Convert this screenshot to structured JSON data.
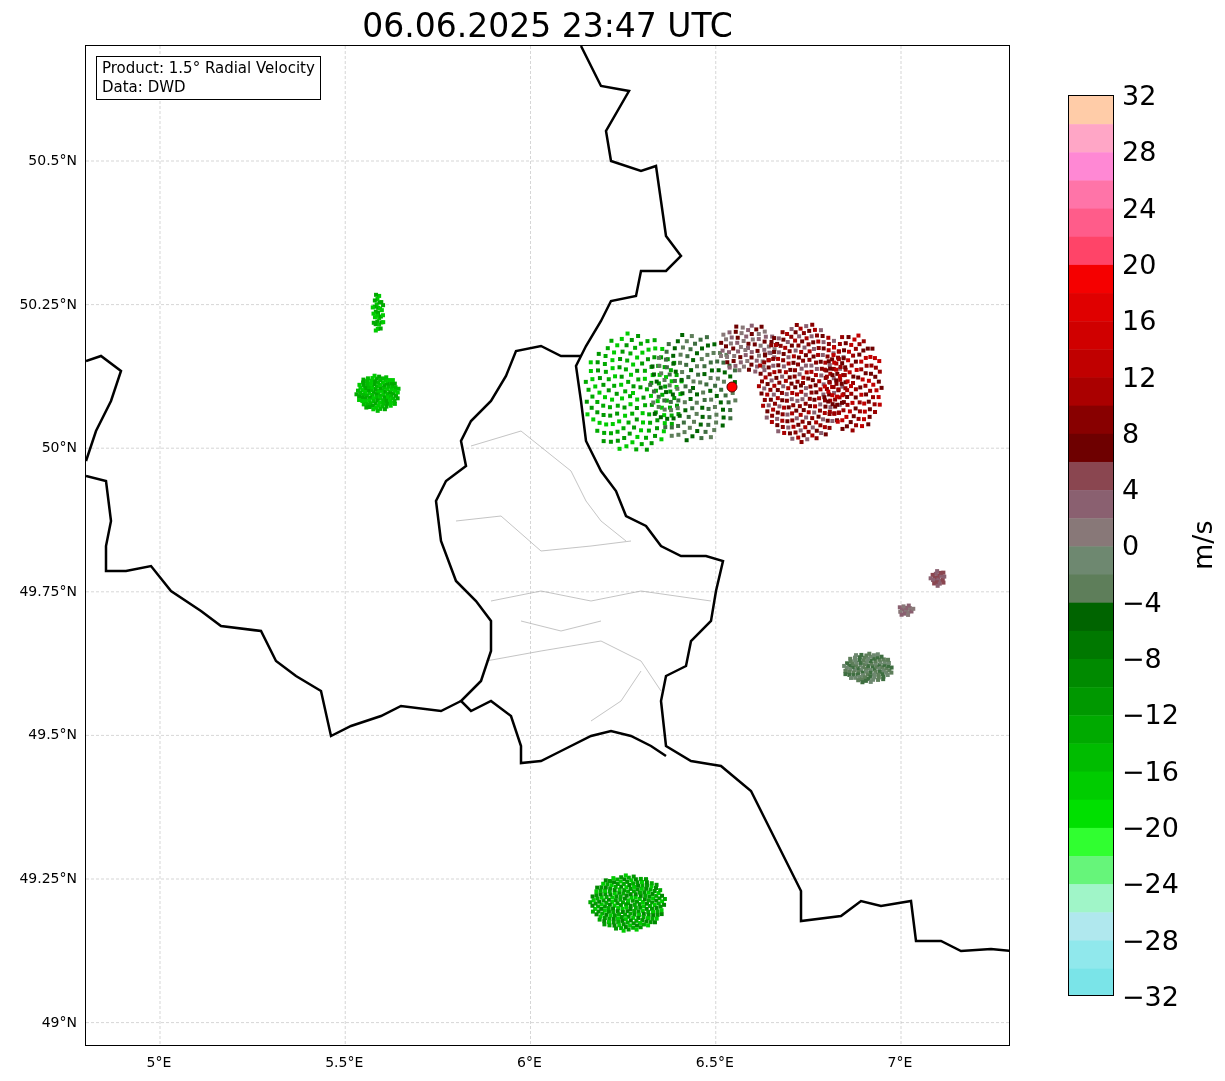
{
  "title": "06.06.2025 23:47 UTC",
  "info_box": [
    "Product: 1.5° Radial Velocity",
    "Data: DWD"
  ],
  "lat_ticks": [
    "50.5°N",
    "50.25°N",
    "50°N",
    "49.75°N",
    "49.5°N",
    "49.25°N",
    "49°N"
  ],
  "lon_ticks": [
    "5°E",
    "5.5°E",
    "6°E",
    "6.5°E",
    "7°E"
  ],
  "colorbar": {
    "label": "m/s",
    "ticks": [
      "32",
      "28",
      "24",
      "20",
      "16",
      "12",
      "8",
      "4",
      "0",
      "−4",
      "−8",
      "−12",
      "−16",
      "−20",
      "−24",
      "−28",
      "−32"
    ]
  }
}
